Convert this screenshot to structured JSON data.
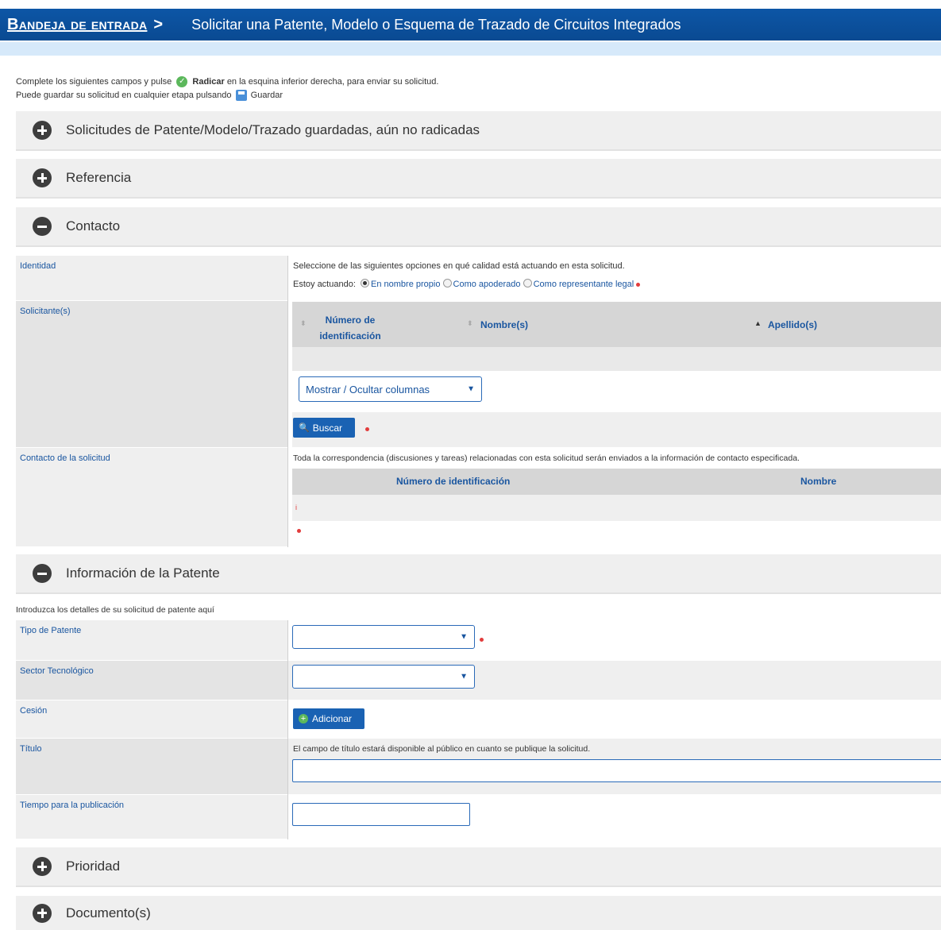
{
  "header": {
    "breadcrumb_link": "Bandeja de entrada",
    "breadcrumb_sep": ">",
    "page_title": "Solicitar una Patente, Modelo o Esquema de Trazado de Circuitos Integrados"
  },
  "intro": {
    "line1_a": "Complete los siguientes campos y pulse",
    "line1_bold": "Radicar",
    "line1_b": "en la esquina inferior derecha, para enviar su solicitud.",
    "line2_a": "Puede guardar su solicitud en cualquier etapa pulsando",
    "line2_b": "Guardar"
  },
  "sections": {
    "saved": "Solicitudes de Patente/Modelo/Trazado guardadas, aún no radicadas",
    "referencia": "Referencia",
    "contacto": "Contacto",
    "info_patente": "Información de la Patente",
    "prioridad": "Prioridad",
    "documentos": "Documento(s)"
  },
  "contacto": {
    "identidad_label": "Identidad",
    "identidad_help": "Seleccione de las siguientes opciones en qué calidad está actuando en esta solicitud.",
    "estoy_actuando": "Estoy actuando:",
    "opt_propio": "En nombre propio",
    "opt_apoderado": "Como apoderado",
    "opt_representante": "Como representante legal",
    "solicitantes_label": "Solicitante(s)",
    "col_numero_1": "Número de",
    "col_numero_2": "identificación",
    "col_nombres": "Nombre(s)",
    "col_apellidos": "Apellido(s)",
    "mostrar_ocultar": "Mostrar / Ocultar columnas",
    "buscar": "Buscar",
    "contacto_label": "Contacto de la solicitud",
    "contacto_help": "Toda la correspondencia (discusiones y tareas) relacionadas con esta solicitud serán enviados a la información de contacto especificada.",
    "col2_numero": "Número de identificación",
    "col2_nombre": "Nombre",
    "row_mark": "i"
  },
  "patente": {
    "help": "Introduzca los detalles de su solicitud de patente aquí",
    "tipo_label": "Tipo de Patente",
    "sector_label": "Sector Tecnológico",
    "cesion_label": "Cesión",
    "adicionar": "Adicionar",
    "titulo_label": "Título",
    "titulo_help": "El campo de título estará disponible al público en cuanto se publique la solicitud.",
    "tiempo_label": "Tiempo para la publicación"
  }
}
